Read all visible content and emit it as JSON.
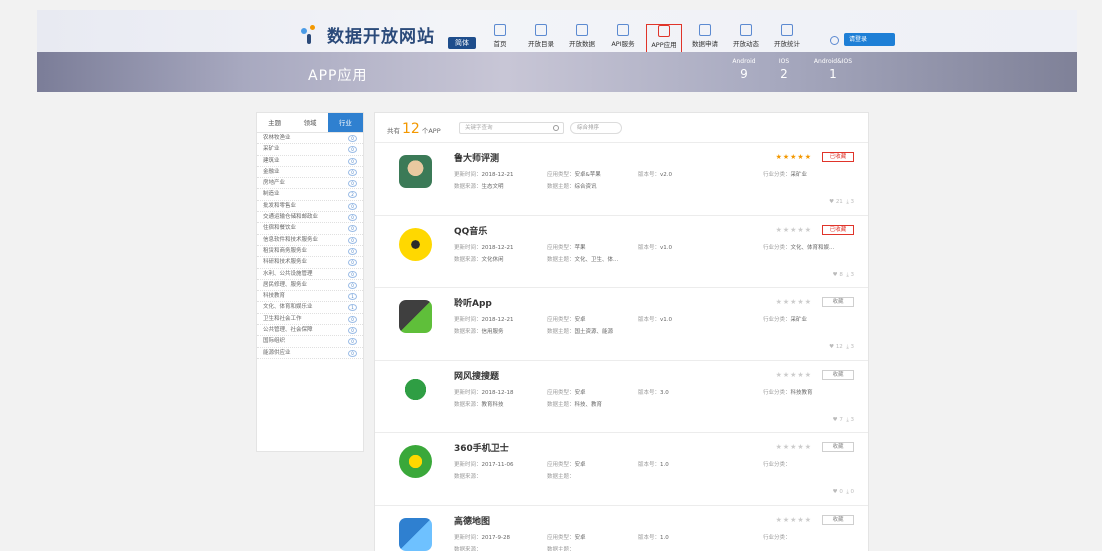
{
  "header": {
    "site_title": "数据开放网站",
    "lang_label": "简体",
    "nav": [
      {
        "label": "首页",
        "icon": "home-icon"
      },
      {
        "label": "开放目录",
        "icon": "catalog-icon"
      },
      {
        "label": "开放数据",
        "icon": "database-icon"
      },
      {
        "label": "API服务",
        "icon": "api-icon"
      },
      {
        "label": "APP应用",
        "icon": "app-icon"
      },
      {
        "label": "数据申请",
        "icon": "apply-icon"
      },
      {
        "label": "开放动态",
        "icon": "news-icon"
      },
      {
        "label": "开放统计",
        "icon": "stats-icon"
      }
    ],
    "user_label": "请登录"
  },
  "banner": {
    "title": "APP应用",
    "stats": [
      {
        "label": "Android",
        "value": "9"
      },
      {
        "label": "IOS",
        "value": "2"
      },
      {
        "label": "Android&IOS",
        "value": "1"
      }
    ]
  },
  "sidebar": {
    "tabs": [
      "主题",
      "领域",
      "行业"
    ],
    "categories": [
      {
        "label": "农林牧渔业",
        "count": "0"
      },
      {
        "label": "采矿业",
        "count": "0"
      },
      {
        "label": "建筑业",
        "count": "0"
      },
      {
        "label": "金融业",
        "count": "0"
      },
      {
        "label": "房地产业",
        "count": "0"
      },
      {
        "label": "制造业",
        "count": "2"
      },
      {
        "label": "批发和零售业",
        "count": "0"
      },
      {
        "label": "交通运输仓储和邮政业",
        "count": "0"
      },
      {
        "label": "住宿和餐饮业",
        "count": "0"
      },
      {
        "label": "信息软件和技术服务业",
        "count": "0"
      },
      {
        "label": "租赁和商务服务业",
        "count": "0"
      },
      {
        "label": "科研和技术服务业",
        "count": "0"
      },
      {
        "label": "水利、公共设施管理",
        "count": "0"
      },
      {
        "label": "居民修理、服务业",
        "count": "0"
      },
      {
        "label": "科技教育",
        "count": "1"
      },
      {
        "label": "文化、体育和娱乐业",
        "count": "1"
      },
      {
        "label": "卫生和社会工作",
        "count": "0"
      },
      {
        "label": "公共管理、社会保障",
        "count": "0"
      },
      {
        "label": "国际组织",
        "count": "0"
      },
      {
        "label": "能源供应业",
        "count": "0"
      }
    ]
  },
  "toolbar": {
    "total_prefix": "共有",
    "total_count": "12",
    "total_suffix": "个APP",
    "search_placeholder": "关键字查询",
    "sort_label": "综合排序"
  },
  "apps": [
    {
      "name": "鲁大师评测",
      "date_label": "更新时间：",
      "date": "2018-12-21",
      "type_label": "应用类型：",
      "type": "安卓&苹果",
      "version_label": "版本号：",
      "version": "v2.0",
      "industry_label": "行业分类：",
      "industry": "采矿业",
      "dept_label": "数据来源：",
      "dept": "生态文明",
      "theme_label": "数据主题：",
      "theme": "综合资讯",
      "views": "21",
      "downloads": "3",
      "stars": 5,
      "fav": "已收藏"
    },
    {
      "name": "QQ音乐",
      "date_label": "更新时间：",
      "date": "2018-12-21",
      "type_label": "应用类型：",
      "type": "苹果",
      "version_label": "版本号：",
      "version": "v1.0",
      "industry_label": "行业分类：",
      "industry": "文化、体育和娱...",
      "dept_label": "数据来源：",
      "dept": "文化休闲",
      "theme_label": "数据主题：",
      "theme": "文化、卫生、体...",
      "views": "8",
      "downloads": "3",
      "stars": 0,
      "fav": "已收藏"
    },
    {
      "name": "聆听App",
      "date_label": "更新时间：",
      "date": "2018-12-21",
      "type_label": "应用类型：",
      "type": "安卓",
      "version_label": "版本号：",
      "version": "v1.0",
      "industry_label": "行业分类：",
      "industry": "采矿业",
      "dept_label": "数据来源：",
      "dept": "信用服务",
      "theme_label": "数据主题：",
      "theme": "国土资源、能源",
      "views": "12",
      "downloads": "3",
      "stars": 0,
      "fav": "收藏"
    },
    {
      "name": "网风搜搜题",
      "date_label": "更新时间：",
      "date": "2018-12-18",
      "type_label": "应用类型：",
      "type": "安卓",
      "version_label": "版本号：",
      "version": "3.0",
      "industry_label": "行业分类：",
      "industry": "科技教育",
      "dept_label": "数据来源：",
      "dept": "教育科技",
      "theme_label": "数据主题：",
      "theme": "科技、教育",
      "views": "7",
      "downloads": "3",
      "stars": 0,
      "fav": "收藏"
    },
    {
      "name": "360手机卫士",
      "date_label": "更新时间：",
      "date": "2017-11-06",
      "type_label": "应用类型：",
      "type": "安卓",
      "version_label": "版本号：",
      "version": "1.0",
      "industry_label": "行业分类：",
      "industry": "",
      "dept_label": "数据来源：",
      "dept": "",
      "theme_label": "数据主题：",
      "theme": "",
      "views": "0",
      "downloads": "0",
      "stars": 0,
      "fav": "收藏"
    },
    {
      "name": "高德地图",
      "date_label": "更新时间：",
      "date": "2017-9-28",
      "type_label": "应用类型：",
      "type": "安卓",
      "version_label": "版本号：",
      "version": "1.0",
      "industry_label": "行业分类：",
      "industry": "",
      "dept_label": "数据来源：",
      "dept": "",
      "theme_label": "数据主题：",
      "theme": "",
      "views": "",
      "downloads": "",
      "stars": 0,
      "fav": "收藏"
    }
  ],
  "colors": {
    "accent": "#2f80d0",
    "highlight": "#f39800",
    "active_border": "#e0342a"
  }
}
